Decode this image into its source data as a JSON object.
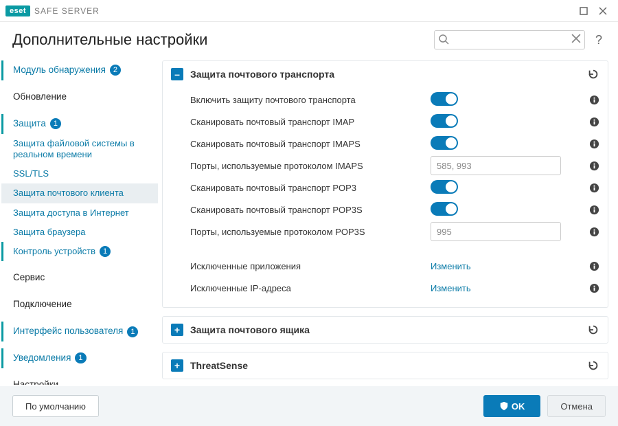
{
  "app": {
    "logo": "eset",
    "product": "SAFE SERVER"
  },
  "header": {
    "title": "Дополнительные настройки",
    "search_placeholder": ""
  },
  "sidebar": {
    "items": [
      {
        "label": "Модуль обнаружения",
        "badge": "2",
        "type": "top",
        "active": true
      },
      {
        "label": "Обновление",
        "type": "top"
      },
      {
        "label": "Защита",
        "badge": "1",
        "type": "top",
        "active": true
      },
      {
        "label": "Защита файловой системы в реальном времени",
        "type": "sub"
      },
      {
        "label": "SSL/TLS",
        "type": "sub"
      },
      {
        "label": "Защита почтового клиента",
        "type": "sub",
        "selected": true
      },
      {
        "label": "Защита доступа в Интернет",
        "type": "sub"
      },
      {
        "label": "Защита браузера",
        "type": "sub"
      },
      {
        "label": "Контроль устройств",
        "badge": "1",
        "type": "sub",
        "active": true
      },
      {
        "label": "Сервис",
        "type": "top"
      },
      {
        "label": "Подключение",
        "type": "top"
      },
      {
        "label": "Интерфейс пользователя",
        "badge": "1",
        "type": "top",
        "active": true
      },
      {
        "label": "Уведомления",
        "badge": "1",
        "type": "top",
        "active": true
      },
      {
        "label": "Настройки конфиденциальности",
        "type": "top"
      }
    ]
  },
  "panels": [
    {
      "key": "mail_transport",
      "title": "Защита почтового транспорта",
      "expanded": true,
      "rows": [
        {
          "kind": "toggle",
          "label": "Включить защиту почтового транспорта",
          "on": true
        },
        {
          "kind": "toggle",
          "label": "Сканировать почтовый транспорт IMAP",
          "on": true
        },
        {
          "kind": "toggle",
          "label": "Сканировать почтовый транспорт IMAPS",
          "on": true
        },
        {
          "kind": "input",
          "label": "Порты, используемые протоколом IMAPS",
          "value": "585, 993"
        },
        {
          "kind": "toggle",
          "label": "Сканировать почтовый транспорт POP3",
          "on": true
        },
        {
          "kind": "toggle",
          "label": "Сканировать почтовый транспорт POP3S",
          "on": true
        },
        {
          "kind": "input",
          "label": "Порты, используемые протоколом POP3S",
          "value": "995"
        },
        {
          "kind": "link",
          "label": "Исключенные приложения",
          "action": "Изменить",
          "gap": true
        },
        {
          "kind": "link",
          "label": "Исключенные IP-адреса",
          "action": "Изменить"
        }
      ]
    },
    {
      "key": "mailbox",
      "title": "Защита почтового ящика",
      "expanded": false
    },
    {
      "key": "threatsense",
      "title": "ThreatSense",
      "expanded": false
    }
  ],
  "footer": {
    "default": "По умолчанию",
    "ok": "OK",
    "cancel": "Отмена"
  }
}
